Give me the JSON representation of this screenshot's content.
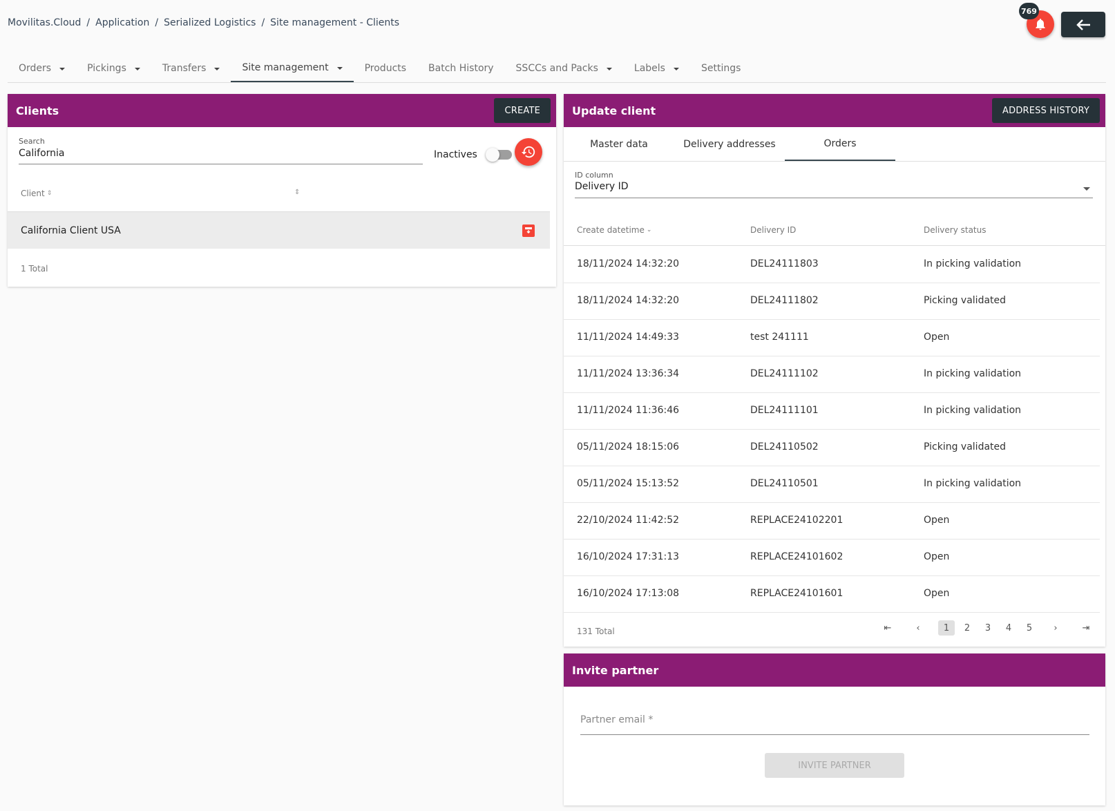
{
  "breadcrumb": [
    "Movilitas.Cloud",
    "Application",
    "Serialized Logistics",
    "Site management - Clients"
  ],
  "header": {
    "notification_count": "769"
  },
  "nav": [
    {
      "label": "Orders",
      "dropdown": true
    },
    {
      "label": "Pickings",
      "dropdown": true
    },
    {
      "label": "Transfers",
      "dropdown": true
    },
    {
      "label": "Site management",
      "dropdown": true,
      "active": true
    },
    {
      "label": "Products",
      "dropdown": false
    },
    {
      "label": "Batch History",
      "dropdown": false
    },
    {
      "label": "SSCCs and Packs",
      "dropdown": true
    },
    {
      "label": "Labels",
      "dropdown": true
    },
    {
      "label": "Settings",
      "dropdown": false
    }
  ],
  "clients": {
    "title": "Clients",
    "create_label": "CREATE",
    "search_label": "Search",
    "search_value": "California",
    "inactives_label": "Inactives",
    "column_client": "Client",
    "rows": [
      "California Client USA"
    ],
    "total": "1 Total"
  },
  "update": {
    "title": "Update client",
    "address_history_label": "ADDRESS HISTORY",
    "tabs": [
      "Master data",
      "Delivery addresses",
      "Orders"
    ],
    "id_column_label": "ID column",
    "id_column_value": "Delivery ID",
    "columns": [
      "Create datetime",
      "Delivery ID",
      "Delivery status"
    ],
    "rows": [
      [
        "18/11/2024 14:32:20",
        "DEL24111803",
        "In picking validation"
      ],
      [
        "18/11/2024 14:32:20",
        "DEL24111802",
        "Picking validated"
      ],
      [
        "11/11/2024 14:49:33",
        "test 241111",
        "Open"
      ],
      [
        "11/11/2024 13:36:34",
        "DEL24111102",
        "In picking validation"
      ],
      [
        "11/11/2024 11:36:46",
        "DEL24111101",
        "In picking validation"
      ],
      [
        "05/11/2024 18:15:06",
        "DEL24110502",
        "Picking validated"
      ],
      [
        "05/11/2024 15:13:52",
        "DEL24110501",
        "In picking validation"
      ],
      [
        "22/10/2024 11:42:52",
        "REPLACE24102201",
        "Open"
      ],
      [
        "16/10/2024 17:31:13",
        "REPLACE24101602",
        "Open"
      ],
      [
        "16/10/2024 17:13:08",
        "REPLACE24101601",
        "Open"
      ]
    ],
    "total": "131 Total",
    "pages": [
      "1",
      "2",
      "3",
      "4",
      "5"
    ]
  },
  "invite": {
    "title": "Invite partner",
    "email_placeholder": "Partner email *",
    "button_label": "INVITE PARTNER"
  }
}
